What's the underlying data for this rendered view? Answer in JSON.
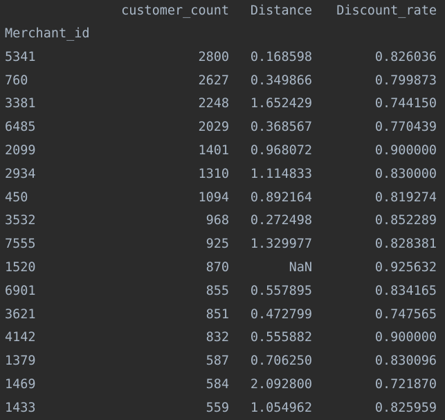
{
  "table": {
    "columns": [
      "customer_count",
      "Distance",
      "Discount_rate"
    ],
    "index_name": "Merchant_id",
    "rows": [
      {
        "id": "5341",
        "customer_count": "2800",
        "distance": "0.168598",
        "discount_rate": "0.826036"
      },
      {
        "id": "760",
        "customer_count": "2627",
        "distance": "0.349866",
        "discount_rate": "0.799873"
      },
      {
        "id": "3381",
        "customer_count": "2248",
        "distance": "1.652429",
        "discount_rate": "0.744150"
      },
      {
        "id": "6485",
        "customer_count": "2029",
        "distance": "0.368567",
        "discount_rate": "0.770439"
      },
      {
        "id": "2099",
        "customer_count": "1401",
        "distance": "0.968072",
        "discount_rate": "0.900000"
      },
      {
        "id": "2934",
        "customer_count": "1310",
        "distance": "1.114833",
        "discount_rate": "0.830000"
      },
      {
        "id": "450",
        "customer_count": "1094",
        "distance": "0.892164",
        "discount_rate": "0.819274"
      },
      {
        "id": "3532",
        "customer_count": "968",
        "distance": "0.272498",
        "discount_rate": "0.852289"
      },
      {
        "id": "7555",
        "customer_count": "925",
        "distance": "1.329977",
        "discount_rate": "0.828381"
      },
      {
        "id": "1520",
        "customer_count": "870",
        "distance": "NaN",
        "discount_rate": "0.925632"
      },
      {
        "id": "6901",
        "customer_count": "855",
        "distance": "0.557895",
        "discount_rate": "0.834165"
      },
      {
        "id": "3621",
        "customer_count": "851",
        "distance": "0.472799",
        "discount_rate": "0.747565"
      },
      {
        "id": "4142",
        "customer_count": "832",
        "distance": "0.555882",
        "discount_rate": "0.900000"
      },
      {
        "id": "1379",
        "customer_count": "587",
        "distance": "0.706250",
        "discount_rate": "0.830096"
      },
      {
        "id": "1469",
        "customer_count": "584",
        "distance": "2.092800",
        "discount_rate": "0.721870"
      },
      {
        "id": "1433",
        "customer_count": "559",
        "distance": "1.054962",
        "discount_rate": "0.825959"
      }
    ]
  },
  "colors": {
    "background": "#2b2b2b",
    "text": "#a9b7c6"
  }
}
